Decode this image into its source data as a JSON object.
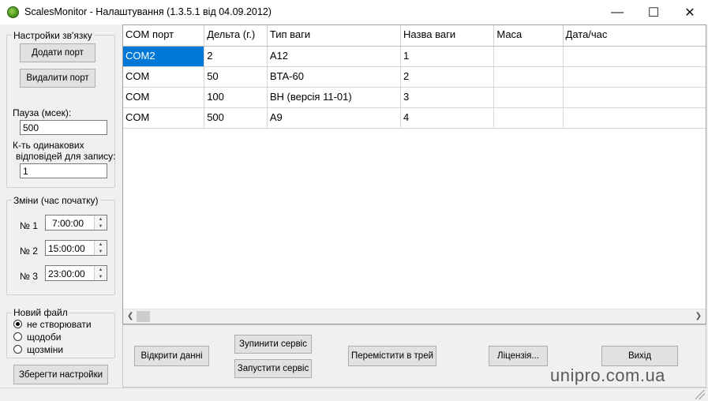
{
  "window": {
    "title": "ScalesMonitor - Налаштування (1.3.5.1 від 04.09.2012)",
    "minimize": "—",
    "maximize": "☐",
    "close": "✕"
  },
  "connection": {
    "group_label": "Настройки зв'язку",
    "add_port": "Додати порт",
    "remove_port": "Видалити порт",
    "pause_label": "Пауза (мсек):",
    "pause_value": "500",
    "same_answers_label_1": "К-ть одинакових",
    "same_answers_label_2": "відповідей для запису:",
    "same_answers_value": "1"
  },
  "shifts": {
    "group_label": "Зміни (час початку)",
    "items": [
      {
        "label": "№ 1",
        "value": "7:00:00"
      },
      {
        "label": "№ 2",
        "value": "15:00:00"
      },
      {
        "label": "№ 3",
        "value": "23:00:00"
      }
    ]
  },
  "new_file": {
    "group_label": "Новий файл",
    "options": [
      "не створювати",
      "щодоби",
      "щозміни"
    ],
    "selected": 0
  },
  "save_settings": "Зберегти настройки",
  "table": {
    "columns": [
      "COM порт",
      "Дельта (г.)",
      "Тип ваги",
      "Назва ваги",
      "Маса",
      "Дата/час"
    ],
    "rows": [
      [
        "COM2",
        "2",
        "A12",
        "1",
        "",
        ""
      ],
      [
        "COM",
        "50",
        "BTA-60",
        "2",
        "",
        ""
      ],
      [
        "COM",
        "100",
        "ВН (версія 11-01)",
        "3",
        "",
        ""
      ],
      [
        "COM",
        "500",
        "A9",
        "4",
        "",
        ""
      ]
    ]
  },
  "buttons": {
    "open_data": "Відкрити данні",
    "stop_service": "Зупинити сервіс",
    "start_service": "Запустити сервіс",
    "move_to_tray": "Перемістити в трей",
    "license": "Ліцензія...",
    "exit": "Вихід"
  },
  "watermark": "unipro.com.ua"
}
